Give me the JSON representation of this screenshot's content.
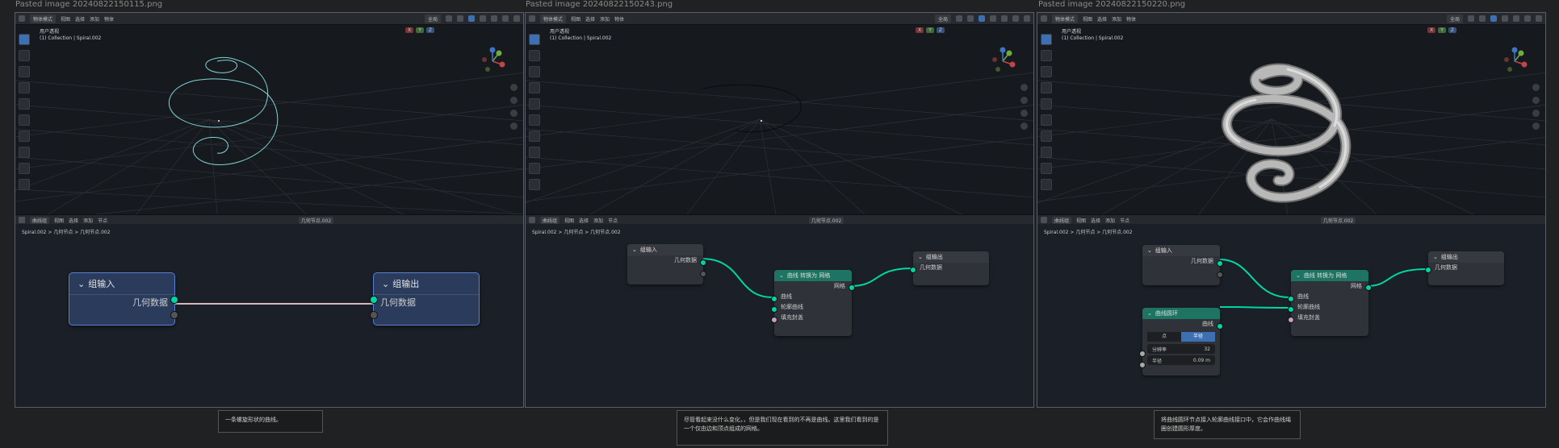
{
  "screens": [
    {
      "filename": "Pasted image 20240822150115.png",
      "header": {
        "mode": "物体模式",
        "menu": [
          "视图",
          "选择",
          "添加",
          "物体"
        ],
        "shading": "全局"
      },
      "viewport": {
        "line1": "用户透视",
        "line2": "(1) Collection | Spiral.002"
      },
      "node_header": {
        "editor": "曲线组",
        "menu": [
          "视图",
          "选择",
          "添加",
          "节点"
        ],
        "tree": "几何节点.002"
      },
      "breadcrumb": [
        "Spiral.002",
        "几何节点",
        "几何节点.002"
      ],
      "caption": "一条螺旋形状的曲线。"
    },
    {
      "filename": "Pasted image 20240822150243.png",
      "header": {
        "mode": "物体模式",
        "menu": [
          "视图",
          "选择",
          "添加",
          "物体"
        ],
        "shading": "全局"
      },
      "viewport": {
        "line1": "用户透视",
        "line2": "(1) Collection | Spiral.002"
      },
      "node_header": {
        "editor": "曲线组",
        "menu": [
          "视图",
          "选择",
          "添加",
          "节点"
        ],
        "tree": "几何节点.002"
      },
      "breadcrumb": [
        "Spiral.002",
        "几何节点",
        "几何节点.002"
      ],
      "caption": "尽管看起来没什么变化，，但是我们现在看到的不再是曲线。这里我们看到的是一个仅由边和顶点组成的网格。"
    },
    {
      "filename": "Pasted image 20240822150220.png",
      "header": {
        "mode": "物体模式",
        "menu": [
          "视图",
          "选择",
          "添加",
          "物体"
        ],
        "shading": "全局"
      },
      "viewport": {
        "line1": "用户透视",
        "line2": "(1) Collection | Spiral.002"
      },
      "node_header": {
        "editor": "曲线组",
        "menu": [
          "视图",
          "选择",
          "添加",
          "节点"
        ],
        "tree": "几何节点.002"
      },
      "breadcrumb": [
        "Spiral.002",
        "几何节点",
        "几何节点.002"
      ],
      "caption": "将曲线圆环节点接入轮廓曲线接口中，它会作曲线绳圈创建圆形厚度。"
    }
  ],
  "axes": {
    "x": "X",
    "y": "Y",
    "z": "Z"
  },
  "nodes": {
    "group_input": "组输入",
    "group_output": "组输出",
    "geometry": "几何数据",
    "curve_to_mesh": "曲线 转换为 网格",
    "curve": "曲线",
    "profile_curve": "轮廓曲线",
    "fill_caps": "填充封盖",
    "mesh": "网格",
    "curve_circle": "曲线圆环",
    "point_tab": "点",
    "radius_tab": "半径",
    "resolution_label": "分辨率",
    "resolution_value": "32",
    "radius_label": "半径",
    "radius_value": "0.09 m"
  },
  "colors": {
    "geometry_socket": "#00d6a3",
    "curve_line": "#7fd6d6",
    "node_header_teal": "#1e7462",
    "selected_blue": "#5a7fd0"
  }
}
